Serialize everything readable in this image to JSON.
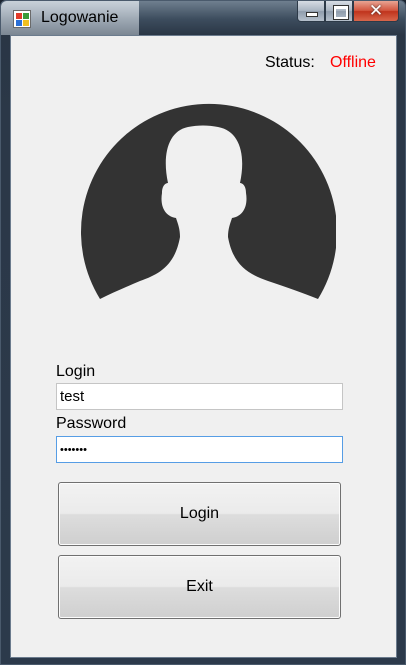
{
  "window": {
    "title": "Logowanie",
    "controls": {
      "minimize": "minimize-icon",
      "maximize": "maximize-icon",
      "close": "✕"
    }
  },
  "status": {
    "label": "Status:",
    "value": "Offline",
    "value_color": "#ff0000"
  },
  "avatar": {
    "icon": "user-silhouette-icon",
    "color": "#333333"
  },
  "form": {
    "login_label": "Login",
    "login_value": "test",
    "password_label": "Password",
    "password_value": "•••••••"
  },
  "buttons": {
    "login": "Login",
    "exit": "Exit"
  }
}
